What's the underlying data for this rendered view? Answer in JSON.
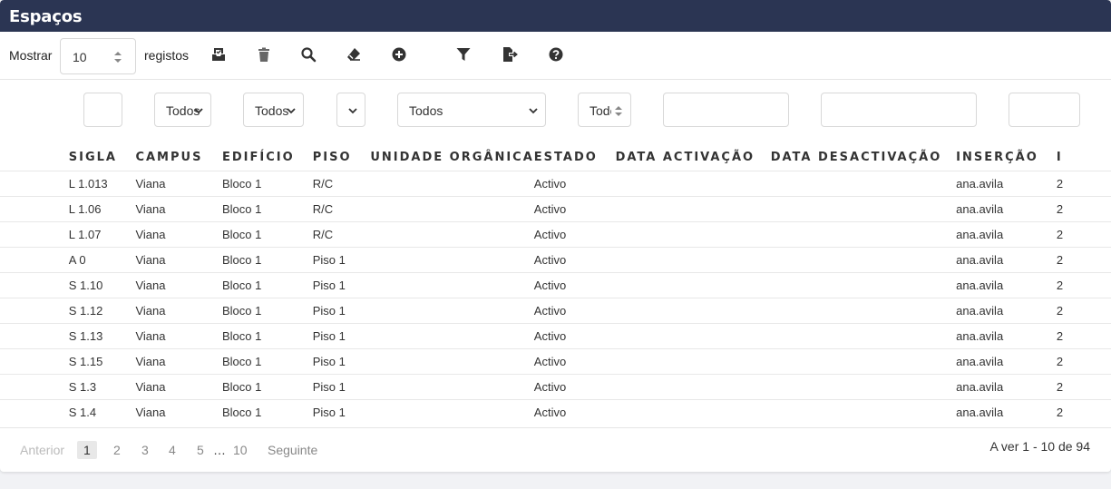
{
  "title": "Espaços",
  "toolbar": {
    "show_label": "Mostrar",
    "page_size": "10",
    "records_label": "registos",
    "icons": [
      "import-icon",
      "trash-icon",
      "search-icon",
      "eraser-icon",
      "add-icon",
      "filter-icon",
      "export-icon",
      "help-icon"
    ]
  },
  "filters": {
    "campus": "Todos",
    "edificio": "Todos",
    "piso": "",
    "unidade": "Todos",
    "estado": "Todos"
  },
  "table": {
    "columns": [
      "SIGLA",
      "CAMPUS",
      "EDIFÍCIO",
      "PISO",
      "UNIDADE ORGÂNICA",
      "ESTADO",
      "DATA ACTIVAÇÃO",
      "DATA DESACTIVAÇÃO",
      "INSERÇÃO",
      "I"
    ],
    "rows": [
      [
        "L 1.013",
        "Viana",
        "Bloco 1",
        "R/C",
        "",
        "Activo",
        "",
        "",
        "ana.avila",
        "2"
      ],
      [
        "L 1.06",
        "Viana",
        "Bloco 1",
        "R/C",
        "",
        "Activo",
        "",
        "",
        "ana.avila",
        "2"
      ],
      [
        "L 1.07",
        "Viana",
        "Bloco 1",
        "R/C",
        "",
        "Activo",
        "",
        "",
        "ana.avila",
        "2"
      ],
      [
        "A 0",
        "Viana",
        "Bloco 1",
        "Piso 1",
        "",
        "Activo",
        "",
        "",
        "ana.avila",
        "2"
      ],
      [
        "S 1.10",
        "Viana",
        "Bloco 1",
        "Piso 1",
        "",
        "Activo",
        "",
        "",
        "ana.avila",
        "2"
      ],
      [
        "S 1.12",
        "Viana",
        "Bloco 1",
        "Piso 1",
        "",
        "Activo",
        "",
        "",
        "ana.avila",
        "2"
      ],
      [
        "S 1.13",
        "Viana",
        "Bloco 1",
        "Piso 1",
        "",
        "Activo",
        "",
        "",
        "ana.avila",
        "2"
      ],
      [
        "S 1.15",
        "Viana",
        "Bloco 1",
        "Piso 1",
        "",
        "Activo",
        "",
        "",
        "ana.avila",
        "2"
      ],
      [
        "S 1.3",
        "Viana",
        "Bloco 1",
        "Piso 1",
        "",
        "Activo",
        "",
        "",
        "ana.avila",
        "2"
      ],
      [
        "S 1.4",
        "Viana",
        "Bloco 1",
        "Piso 1",
        "",
        "Activo",
        "",
        "",
        "ana.avila",
        "2"
      ]
    ]
  },
  "pagination": {
    "prev": "Anterior",
    "pages": [
      "1",
      "2",
      "3",
      "4",
      "5"
    ],
    "ellipsis": "…",
    "last": "10",
    "next": "Seguinte",
    "info": "A ver 1 - 10 de 94"
  }
}
